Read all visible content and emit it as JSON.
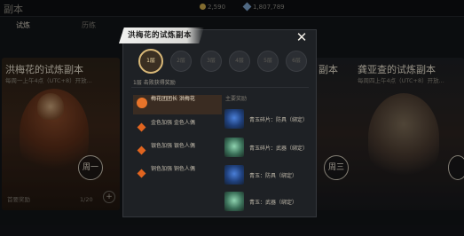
{
  "header": {
    "title": "副本",
    "currency_gold": "2,590",
    "currency_gem": "1,807,789"
  },
  "tabs": [
    {
      "label": "试炼"
    },
    {
      "label": "历练"
    }
  ],
  "left_card": {
    "name": "洪梅花的试炼副本",
    "sub": "每周一上午4点（UTC+8）开放...",
    "day": "周一",
    "footer": "首要奖励",
    "count": "1/20"
  },
  "right_card": {
    "name": "龚亚查的试炼副本",
    "sub": "每周四上午4点（UTC+8）开放...",
    "day": "周三",
    "prev_name": "副本",
    "prev_sub": "UTC+8 开放"
  },
  "modal": {
    "title": "洪梅花的试炼副本",
    "close_icon": "close-icon",
    "stages": [
      "1层",
      "2层",
      "3层",
      "4层",
      "5层",
      "6层"
    ],
    "active_stage_index": 0,
    "stage_caption": "1层 击败获得奖励",
    "rewards_label": "主要奖励",
    "enemies": [
      {
        "name": "梅花团团长 洪梅花"
      },
      {
        "name": "金色加强 金色人偶"
      },
      {
        "name": "银色加强 银色人偶"
      },
      {
        "name": "铜色加强 铜色人偶"
      }
    ],
    "rewards": [
      {
        "name": "青玉碎片：防具（绑定）",
        "color": "blue"
      },
      {
        "name": "青玉碎片：武器（绑定）",
        "color": "green"
      },
      {
        "name": "青玉：防具（绑定）",
        "color": "blue"
      },
      {
        "name": "青玉：武器（绑定）",
        "color": "green"
      }
    ]
  },
  "colors": {
    "accent_orange": "#e0641f",
    "gold_ring": "#d8b878"
  }
}
